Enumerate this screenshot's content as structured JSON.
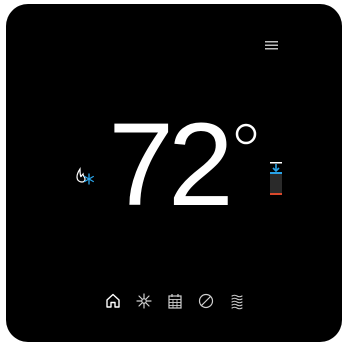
{
  "display": {
    "temperature": "72",
    "degree_symbol": "°"
  },
  "icons": {
    "menu": "hamburger-menu-icon",
    "mode": "heat-cool-mode-icon",
    "setpoint": "setpoint-slider-icon",
    "nav_home": "home-icon",
    "nav_fan": "fan-icon",
    "nav_schedule": "calendar-icon",
    "nav_eco": "leaf-icon",
    "nav_humidity": "humidity-waves-icon"
  },
  "colors": {
    "background": "#000000",
    "foreground": "#ffffff",
    "cool_accent": "#29a3e8",
    "heat_accent": "#d9482b",
    "nav_icon": "#cfcfcf"
  }
}
